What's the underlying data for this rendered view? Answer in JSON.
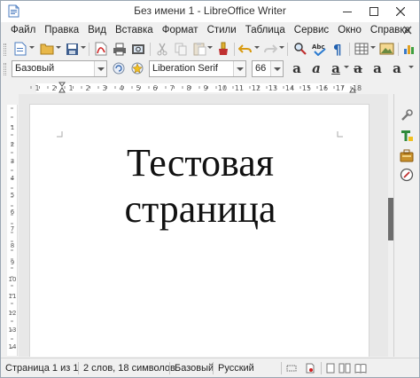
{
  "window": {
    "title": "Без имени 1 - LibreOffice Writer"
  },
  "menu": {
    "items": [
      "Файл",
      "Правка",
      "Вид",
      "Вставка",
      "Формат",
      "Стили",
      "Таблица",
      "Сервис",
      "Окно",
      "Справка"
    ]
  },
  "toolbar_standard": {
    "icons": [
      "new-document-icon",
      "open-folder-icon",
      "save-icon",
      "export-pdf-icon",
      "print-icon",
      "print-preview-icon",
      "cut-icon",
      "copy-icon",
      "paste-icon",
      "clone-formatting-icon",
      "undo-icon",
      "redo-icon",
      "find-replace-icon",
      "spelling-icon",
      "formatting-marks-icon",
      "insert-table-icon",
      "insert-image-icon"
    ]
  },
  "toolbar_formatting": {
    "paragraph_style": "Базовый",
    "font_name": "Liberation Serif",
    "font_size": "66",
    "icons": [
      "update-style-icon",
      "new-style-icon",
      "bold-icon",
      "italic-icon",
      "underline-icon",
      "strikethrough-icon",
      "superscript-icon",
      "subscript-icon"
    ],
    "letters": [
      "a",
      "a",
      "a",
      "a",
      "a",
      "a"
    ]
  },
  "ruler": {
    "h_labels": [
      "1",
      "2",
      "1",
      "2",
      "3",
      "4",
      "5",
      "6",
      "7",
      "8",
      "9",
      "10",
      "11",
      "12",
      "13",
      "14",
      "15",
      "16",
      "17",
      "18"
    ],
    "v_labels": [
      "1",
      "2",
      "3",
      "4",
      "5",
      "6",
      "7",
      "8",
      "9",
      "10",
      "11",
      "12",
      "13",
      "14"
    ]
  },
  "document": {
    "line1": "Тестовая",
    "line2": "страница"
  },
  "sidebar": {
    "icons": [
      "properties-icon",
      "styles-icon",
      "gallery-icon",
      "navigator-icon"
    ]
  },
  "status": {
    "page": "Страница 1 из 1",
    "words": "2 слов, 18 символов",
    "style": "Базовый",
    "language": "Русский"
  },
  "colors": {
    "accent_blue": "#1e6cc0",
    "window_bg": "#f0f0f0",
    "scroll_handle": "#6d6d6d"
  }
}
